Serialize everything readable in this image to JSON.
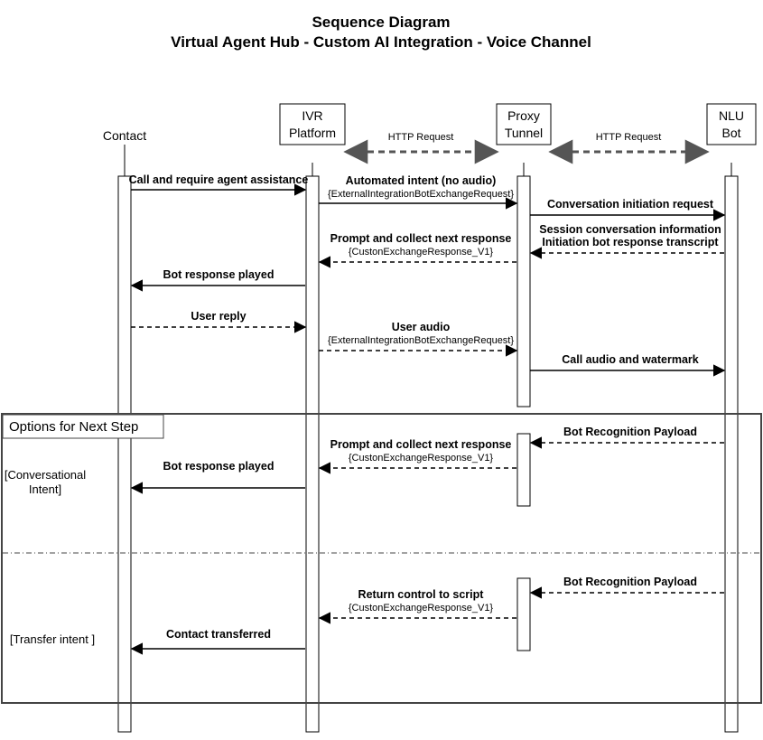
{
  "title1": "Sequence Diagram",
  "title2": "Virtual Agent Hub -  Custom AI Integration - Voice Channel",
  "actors": {
    "contact": "Contact",
    "ivr": "IVR Platform",
    "proxy": "Proxy Tunnel",
    "nlu": "NLU Bot"
  },
  "link_ivr_proxy": "HTTP Request",
  "link_proxy_nlu": "HTTP Request",
  "options_box_title": "Options for Next Step",
  "case1": "[Conversational Intent]",
  "case2": "[Transfer intent ]",
  "msgs": {
    "m1": "Call and require agent assistance",
    "m2": "Automated intent (no audio)",
    "m2s": "{ExternalIntegrationBotExchangeRequest}",
    "m3": "Conversation initiation request",
    "m4a": "Session conversation information",
    "m4b": "Initiation bot response transcript",
    "m5": "Prompt and collect next response",
    "m5s": "{CustonExchangeResponse_V1}",
    "m6": "Bot response played",
    "m7": "User reply",
    "m8": "User audio",
    "m8s": "{ExternalIntegrationBotExchangeRequest}",
    "m9": "Call audio and watermark",
    "m10": "Bot Recognition Payload",
    "m11": "Prompt and collect next response",
    "m11s": "{CustonExchangeResponse_V1}",
    "m12": "Bot response played",
    "m13": "Bot Recognition Payload",
    "m14": "Return control to script",
    "m14s": "{CustonExchangeResponse_V1}",
    "m15": "Contact transferred"
  }
}
